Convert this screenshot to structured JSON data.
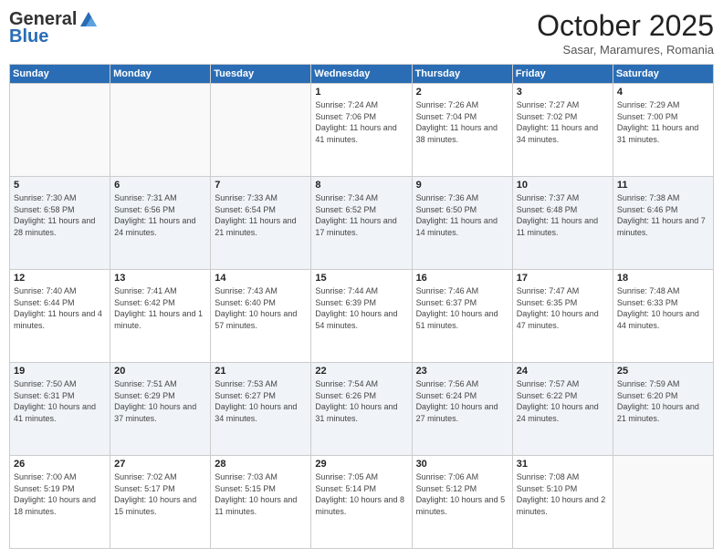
{
  "header": {
    "logo_general": "General",
    "logo_blue": "Blue",
    "month": "October 2025",
    "location": "Sasar, Maramures, Romania"
  },
  "days_of_week": [
    "Sunday",
    "Monday",
    "Tuesday",
    "Wednesday",
    "Thursday",
    "Friday",
    "Saturday"
  ],
  "weeks": [
    [
      {
        "day": "",
        "info": ""
      },
      {
        "day": "",
        "info": ""
      },
      {
        "day": "",
        "info": ""
      },
      {
        "day": "1",
        "info": "Sunrise: 7:24 AM\nSunset: 7:06 PM\nDaylight: 11 hours and 41 minutes."
      },
      {
        "day": "2",
        "info": "Sunrise: 7:26 AM\nSunset: 7:04 PM\nDaylight: 11 hours and 38 minutes."
      },
      {
        "day": "3",
        "info": "Sunrise: 7:27 AM\nSunset: 7:02 PM\nDaylight: 11 hours and 34 minutes."
      },
      {
        "day": "4",
        "info": "Sunrise: 7:29 AM\nSunset: 7:00 PM\nDaylight: 11 hours and 31 minutes."
      }
    ],
    [
      {
        "day": "5",
        "info": "Sunrise: 7:30 AM\nSunset: 6:58 PM\nDaylight: 11 hours and 28 minutes."
      },
      {
        "day": "6",
        "info": "Sunrise: 7:31 AM\nSunset: 6:56 PM\nDaylight: 11 hours and 24 minutes."
      },
      {
        "day": "7",
        "info": "Sunrise: 7:33 AM\nSunset: 6:54 PM\nDaylight: 11 hours and 21 minutes."
      },
      {
        "day": "8",
        "info": "Sunrise: 7:34 AM\nSunset: 6:52 PM\nDaylight: 11 hours and 17 minutes."
      },
      {
        "day": "9",
        "info": "Sunrise: 7:36 AM\nSunset: 6:50 PM\nDaylight: 11 hours and 14 minutes."
      },
      {
        "day": "10",
        "info": "Sunrise: 7:37 AM\nSunset: 6:48 PM\nDaylight: 11 hours and 11 minutes."
      },
      {
        "day": "11",
        "info": "Sunrise: 7:38 AM\nSunset: 6:46 PM\nDaylight: 11 hours and 7 minutes."
      }
    ],
    [
      {
        "day": "12",
        "info": "Sunrise: 7:40 AM\nSunset: 6:44 PM\nDaylight: 11 hours and 4 minutes."
      },
      {
        "day": "13",
        "info": "Sunrise: 7:41 AM\nSunset: 6:42 PM\nDaylight: 11 hours and 1 minute."
      },
      {
        "day": "14",
        "info": "Sunrise: 7:43 AM\nSunset: 6:40 PM\nDaylight: 10 hours and 57 minutes."
      },
      {
        "day": "15",
        "info": "Sunrise: 7:44 AM\nSunset: 6:39 PM\nDaylight: 10 hours and 54 minutes."
      },
      {
        "day": "16",
        "info": "Sunrise: 7:46 AM\nSunset: 6:37 PM\nDaylight: 10 hours and 51 minutes."
      },
      {
        "day": "17",
        "info": "Sunrise: 7:47 AM\nSunset: 6:35 PM\nDaylight: 10 hours and 47 minutes."
      },
      {
        "day": "18",
        "info": "Sunrise: 7:48 AM\nSunset: 6:33 PM\nDaylight: 10 hours and 44 minutes."
      }
    ],
    [
      {
        "day": "19",
        "info": "Sunrise: 7:50 AM\nSunset: 6:31 PM\nDaylight: 10 hours and 41 minutes."
      },
      {
        "day": "20",
        "info": "Sunrise: 7:51 AM\nSunset: 6:29 PM\nDaylight: 10 hours and 37 minutes."
      },
      {
        "day": "21",
        "info": "Sunrise: 7:53 AM\nSunset: 6:27 PM\nDaylight: 10 hours and 34 minutes."
      },
      {
        "day": "22",
        "info": "Sunrise: 7:54 AM\nSunset: 6:26 PM\nDaylight: 10 hours and 31 minutes."
      },
      {
        "day": "23",
        "info": "Sunrise: 7:56 AM\nSunset: 6:24 PM\nDaylight: 10 hours and 27 minutes."
      },
      {
        "day": "24",
        "info": "Sunrise: 7:57 AM\nSunset: 6:22 PM\nDaylight: 10 hours and 24 minutes."
      },
      {
        "day": "25",
        "info": "Sunrise: 7:59 AM\nSunset: 6:20 PM\nDaylight: 10 hours and 21 minutes."
      }
    ],
    [
      {
        "day": "26",
        "info": "Sunrise: 7:00 AM\nSunset: 5:19 PM\nDaylight: 10 hours and 18 minutes."
      },
      {
        "day": "27",
        "info": "Sunrise: 7:02 AM\nSunset: 5:17 PM\nDaylight: 10 hours and 15 minutes."
      },
      {
        "day": "28",
        "info": "Sunrise: 7:03 AM\nSunset: 5:15 PM\nDaylight: 10 hours and 11 minutes."
      },
      {
        "day": "29",
        "info": "Sunrise: 7:05 AM\nSunset: 5:14 PM\nDaylight: 10 hours and 8 minutes."
      },
      {
        "day": "30",
        "info": "Sunrise: 7:06 AM\nSunset: 5:12 PM\nDaylight: 10 hours and 5 minutes."
      },
      {
        "day": "31",
        "info": "Sunrise: 7:08 AM\nSunset: 5:10 PM\nDaylight: 10 hours and 2 minutes."
      },
      {
        "day": "",
        "info": ""
      }
    ]
  ]
}
